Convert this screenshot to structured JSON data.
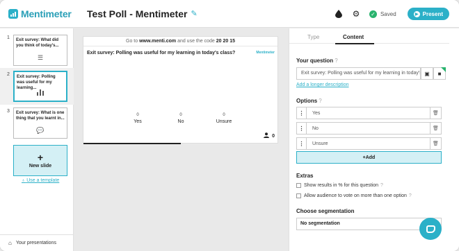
{
  "header": {
    "logo_text": "Mentimeter",
    "title": "Test Poll - Mentimeter",
    "saved_label": "Saved",
    "present_label": "Present"
  },
  "slides": {
    "items": [
      {
        "num": "1",
        "text": "Exit survey: What did you think of today's...",
        "icon": "sliders-icon"
      },
      {
        "num": "2",
        "text": "Exit survey: Polling was useful for my learning...",
        "icon": "bar-chart-icon"
      },
      {
        "num": "3",
        "text": "Exit survey: What is one thing that you learnt in...",
        "icon": "speech-bubbles-icon"
      }
    ],
    "new_slide_label": "New slide",
    "template_link": "Use a template",
    "your_presentations": "Your presentations"
  },
  "preview": {
    "code_prefix": "Go to",
    "url": "www.menti.com",
    "code_mid": "and use the code",
    "code": "20 20 15",
    "question": "Exit survey: Polling was useful for my learning in today's class?",
    "brand": "Mentimeter",
    "options": [
      {
        "label": "Yes",
        "value": "0"
      },
      {
        "label": "No",
        "value": "0"
      },
      {
        "label": "Unsure",
        "value": "0"
      }
    ],
    "responses": "0"
  },
  "panel": {
    "tab_type": "Type",
    "tab_content": "Content",
    "your_question_label": "Your question",
    "question_value": "Exit survey: Polling was useful for my learning in today's class?",
    "longer_desc_link": "Add a longer description",
    "options_label": "Options",
    "options": [
      "Yes",
      "No",
      "Unsure"
    ],
    "add_label": "+Add",
    "extras_label": "Extras",
    "extra_1": "Show results in % for this question",
    "extra_2": "Allow audience to vote on more than one option",
    "segmentation_label": "Choose segmentation",
    "segmentation_value": "No segmentation"
  },
  "colors": {
    "accent": "#2bb0c8",
    "saved_green": "#29b36e"
  }
}
